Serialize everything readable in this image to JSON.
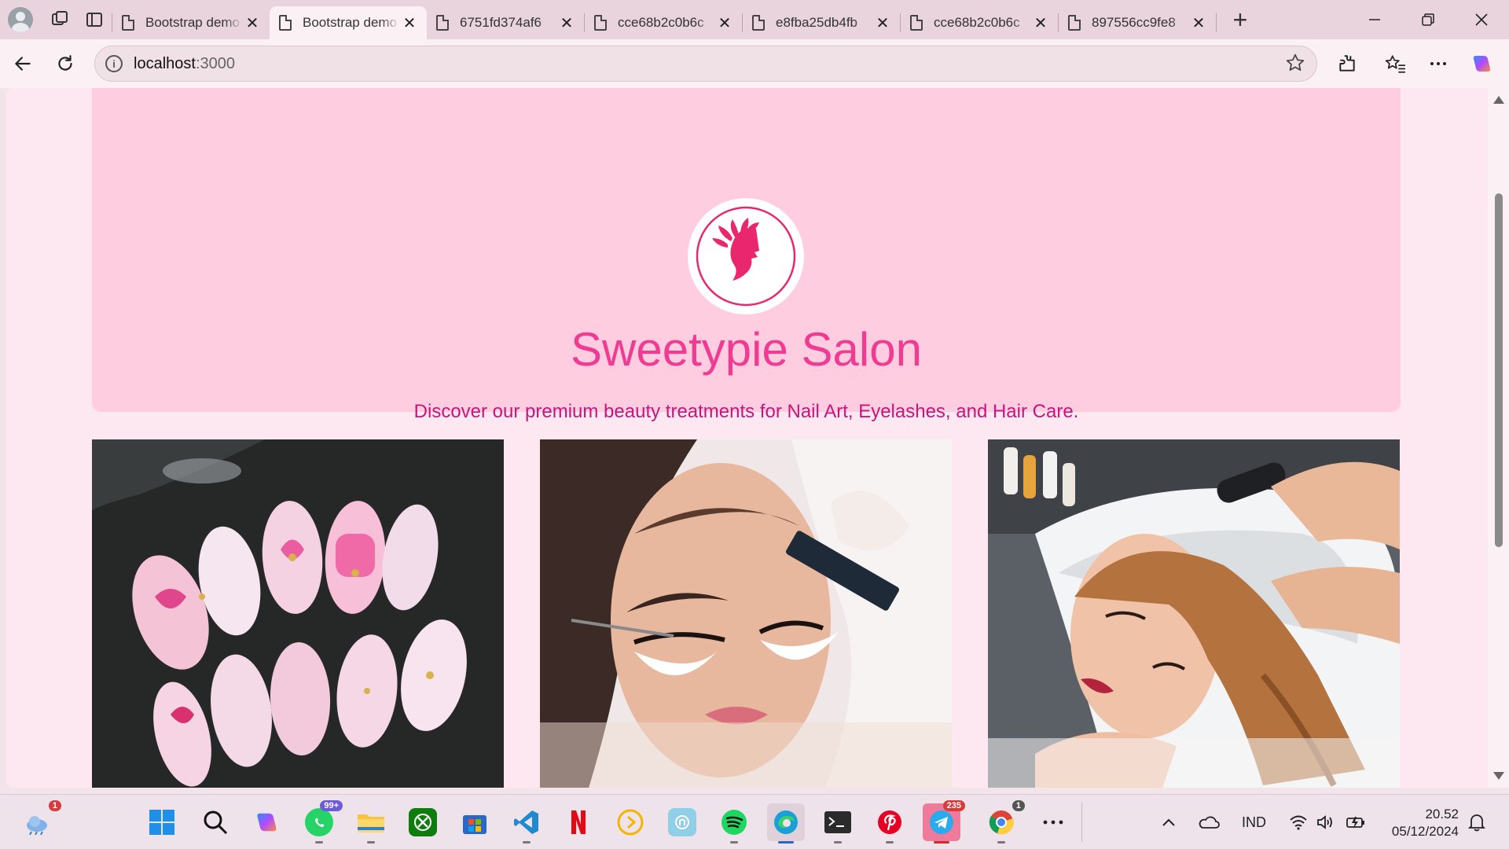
{
  "browser": {
    "tabs": [
      {
        "title": "Bootstrap demo",
        "active": false
      },
      {
        "title": "Bootstrap demo",
        "active": true
      },
      {
        "title": "6751fd374af6",
        "active": false
      },
      {
        "title": "cce68b2c0b6c",
        "active": false
      },
      {
        "title": "e8fba25db4fb",
        "active": false
      },
      {
        "title": "cce68b2c0b6c",
        "active": false
      },
      {
        "title": "897556cc9fe8",
        "active": false
      }
    ],
    "close_glyph": "✕",
    "new_tab_glyph": "+",
    "url_host": "localhost",
    "url_port": ":3000"
  },
  "page": {
    "brand_title": "Sweetypie Salon",
    "tagline": "Discover our premium beauty treatments for Nail Art, Eyelashes, and Hair Care.",
    "cards": [
      {
        "image": "nail-art-photo"
      },
      {
        "image": "eyelash-extension-photo"
      },
      {
        "image": "hair-wash-photo"
      }
    ]
  },
  "taskbar": {
    "apps": [
      {
        "name": "weather",
        "badge": "1"
      },
      {
        "name": "start"
      },
      {
        "name": "search"
      },
      {
        "name": "copilot"
      },
      {
        "name": "whatsapp",
        "badge": "99+"
      },
      {
        "name": "file-explorer"
      },
      {
        "name": "xbox"
      },
      {
        "name": "microsoft-store"
      },
      {
        "name": "vs-code"
      },
      {
        "name": "netflix"
      },
      {
        "name": "player"
      },
      {
        "name": "app"
      },
      {
        "name": "spotify"
      },
      {
        "name": "edge"
      },
      {
        "name": "terminal"
      },
      {
        "name": "pinterest"
      },
      {
        "name": "telegram",
        "badge": "235"
      },
      {
        "name": "chrome",
        "badge": "1"
      },
      {
        "name": "more"
      }
    ],
    "language": "IND",
    "time": "20.52",
    "date": "05/12/2024"
  },
  "colors": {
    "hero_bg": "#ffcce0",
    "title": "#ef3c92",
    "tagline": "#c7157a",
    "page_bg": "#fde8f1"
  }
}
